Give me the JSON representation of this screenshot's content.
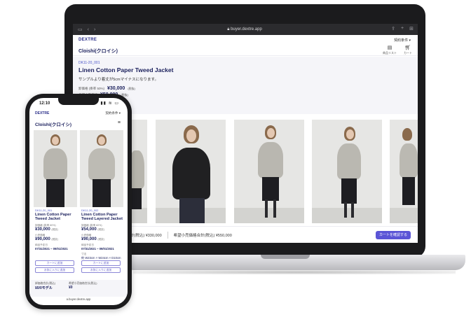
{
  "laptop": {
    "browser": {
      "url": "buyer.dextre.app"
    },
    "site": {
      "brand": "DEXTRE",
      "menu": "契約条件 ▾",
      "store_name": "Cloishi(クロイシ)",
      "icons": [
        {
          "name": "bookmark-icon",
          "label": "商品リスト"
        },
        {
          "name": "cart-icon",
          "label": "カート"
        }
      ]
    },
    "product": {
      "code": "DK11-20_001",
      "name": "Linen Cotton Paper Tweed Jacket",
      "note": "サンプルより着丈が5cmマイナスになります。",
      "price_label1": "卸価格 (掛率 50%)",
      "price1": "¥30,000",
      "price_tag1": "(税抜)",
      "price_label2": "希望小売価格",
      "price2": "¥50,000",
      "price_tag2": "(税抜)"
    },
    "footer": {
      "item1": "卸価格合計(税込) ¥330,000",
      "item2": "希望小売価格合計(税込) ¥550,000",
      "cart_button": "カートを確認する"
    }
  },
  "phone": {
    "time": "12:10",
    "brand": "DEXTRE",
    "menu": "契約条件 ▾",
    "store_name": "Cloishi(クロイシ)",
    "products": [
      {
        "code": "DK11-20_001",
        "name": "Linen Cotton Paper Tweed Jacket",
        "price_label": "卸価格 (掛率 60%)",
        "price": "¥30,000",
        "tag": "(税抜)",
        "retail_label": "小売価格",
        "retail": "¥90,000",
        "retail_tag": "(税抜)",
        "date_label": "納品予定日",
        "date": "07/31/2021 ~ 09/01/2021",
        "size_label": "",
        "size": "",
        "btn1": "カートに追加",
        "btn2": "お気に入りに追加"
      },
      {
        "code": "DK11-20_002",
        "name": "Linen Cotton Paper Tweed Layered Jacket",
        "price_label": "卸価格 (掛率 60%)",
        "price": "¥54,000",
        "tag": "(税抜)",
        "retail_label": "小売価格",
        "retail": "¥90,000",
        "retail_tag": "(税抜)",
        "date_label": "納品予定日",
        "date": "07/31/2021 ~ 09/01/2021",
        "size_label": "寸法",
        "size": "約 W23cm × W24cm × D10cm",
        "btn1": "カートに追加",
        "btn2": "お気に入りに追加"
      }
    ],
    "footer": {
      "label1": "卸価格合計(税込)",
      "value1": "¥0/0モデル",
      "label2": "希望小売価格合計(税込)",
      "value2": "¥0"
    },
    "url": "a.buyer.dextre.app"
  }
}
